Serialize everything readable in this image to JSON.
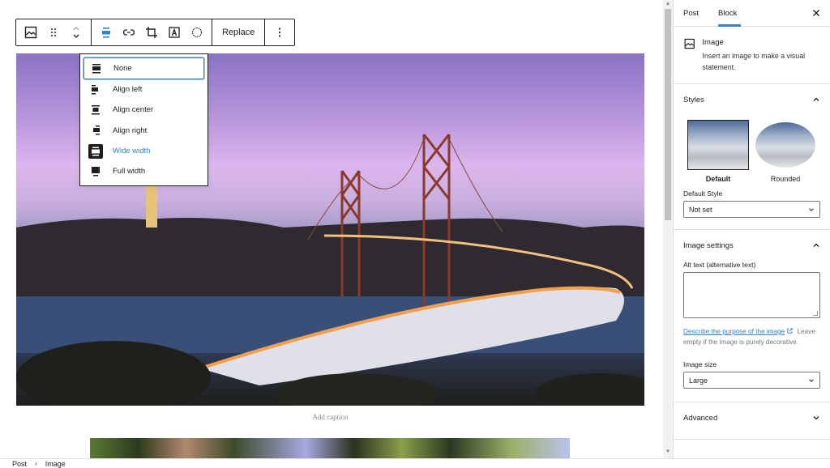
{
  "toolbar": {
    "buttons": [
      {
        "name": "image-block-icon"
      },
      {
        "name": "drag-handle-icon"
      },
      {
        "name": "move-up-down-icon"
      },
      {
        "name": "align-icon"
      },
      {
        "name": "link-icon"
      },
      {
        "name": "crop-icon"
      },
      {
        "name": "text-overlay-icon"
      },
      {
        "name": "duotone-icon"
      }
    ],
    "replace_label": "Replace",
    "more_options_icon": "vertical-ellipsis"
  },
  "align_menu": {
    "items": [
      {
        "label": "None",
        "icon": "align-none",
        "focused": true
      },
      {
        "label": "Align left",
        "icon": "align-left"
      },
      {
        "label": "Align center",
        "icon": "align-center"
      },
      {
        "label": "Align right",
        "icon": "align-right"
      },
      {
        "label": "Wide width",
        "icon": "align-wide",
        "active": true
      },
      {
        "label": "Full width",
        "icon": "align-full"
      }
    ]
  },
  "canvas": {
    "caption_placeholder": "Add caption"
  },
  "sidebar": {
    "tabs": [
      {
        "label": "Post"
      },
      {
        "label": "Block",
        "active": true
      }
    ],
    "block": {
      "title": "Image",
      "description": "Insert an image to make a visual statement."
    },
    "styles": {
      "title": "Styles",
      "options": [
        {
          "label": "Default",
          "selected": true
        },
        {
          "label": "Rounded"
        }
      ],
      "default_style_label": "Default Style",
      "default_style_value": "Not set"
    },
    "image_settings": {
      "title": "Image settings",
      "alt_label": "Alt text (alternative text)",
      "alt_value": "",
      "help_link": "Describe the purpose of the image",
      "help_rest": " Leave empty if the image is purely decorative.",
      "size_label": "Image size",
      "size_value": "Large"
    },
    "advanced": {
      "title": "Advanced"
    }
  },
  "breadcrumb": {
    "items": [
      "Post",
      "Image"
    ]
  },
  "colors": {
    "accent": "#3582c4",
    "text": "#1e1e1e",
    "border": "#e0e0e0"
  }
}
